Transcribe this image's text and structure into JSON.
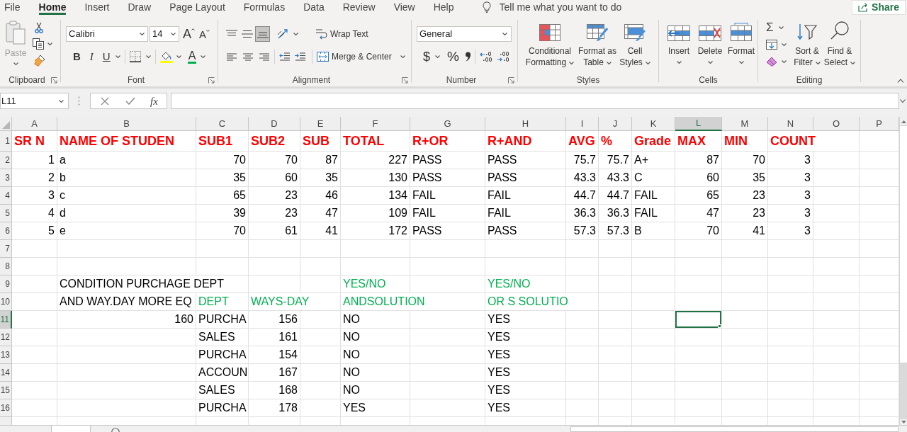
{
  "tabs": [
    {
      "label": "File",
      "selected": false
    },
    {
      "label": "Home",
      "selected": true
    },
    {
      "label": "Insert",
      "selected": false
    },
    {
      "label": "Draw",
      "selected": false
    },
    {
      "label": "Page Layout",
      "selected": false
    },
    {
      "label": "Formulas",
      "selected": false
    },
    {
      "label": "Data",
      "selected": false
    },
    {
      "label": "Review",
      "selected": false
    },
    {
      "label": "View",
      "selected": false
    },
    {
      "label": "Help",
      "selected": false
    }
  ],
  "tell_me": {
    "placeholder": "Tell me what you want to do"
  },
  "share_button": {
    "label": "Share"
  },
  "ribbon": {
    "clipboard": {
      "label": "Clipboard",
      "paste": {
        "label": "Paste",
        "disabled": true
      }
    },
    "font": {
      "label": "Font",
      "font_name": "Calibri",
      "font_size": "14",
      "grow_font": "A",
      "shrink_font": "A",
      "bold": "B",
      "italic": "I",
      "underline": "U",
      "font_color": "A"
    },
    "alignment": {
      "label": "Alignment",
      "vertical_align": [
        {
          "kind": "top",
          "selected": false
        },
        {
          "kind": "middle",
          "selected": false
        },
        {
          "kind": "bottom",
          "selected": true
        }
      ],
      "wrap_text": "Wrap Text",
      "merge_center": "Merge & Center"
    },
    "number": {
      "label": "Number",
      "format": "General",
      "currency": "$",
      "percent": "%"
    },
    "styles": {
      "label": "Styles",
      "buttons": [
        {
          "kind": "conditional",
          "lines": [
            "Conditional",
            "Formatting"
          ]
        },
        {
          "kind": "table",
          "lines": [
            "Format as",
            "Table"
          ]
        },
        {
          "kind": "cell_styles",
          "lines": [
            "Cell",
            "Styles"
          ]
        }
      ]
    },
    "cells": {
      "label": "Cells",
      "buttons": [
        {
          "kind": "insert",
          "label": "Insert"
        },
        {
          "kind": "delete",
          "label": "Delete"
        },
        {
          "kind": "format",
          "label": "Format"
        }
      ]
    },
    "editing": {
      "label": "Editing",
      "autosum": "Σ",
      "buttons": [
        {
          "kind": "sort",
          "lines": [
            "Sort &",
            "Filter"
          ]
        },
        {
          "kind": "find",
          "lines": [
            "Find &",
            "Select"
          ]
        }
      ]
    }
  },
  "formula_bar": {
    "name_box": "L11",
    "function_button": "fx"
  },
  "sheet": {
    "columns": [
      {
        "label": "A",
        "selected": false
      },
      {
        "label": "B",
        "selected": false
      },
      {
        "label": "C",
        "selected": false
      },
      {
        "label": "D",
        "selected": false
      },
      {
        "label": "E",
        "selected": false
      },
      {
        "label": "F",
        "selected": false
      },
      {
        "label": "G",
        "selected": false
      },
      {
        "label": "H",
        "selected": false
      },
      {
        "label": "I",
        "selected": false
      },
      {
        "label": "J",
        "selected": false
      },
      {
        "label": "K",
        "selected": false
      },
      {
        "label": "L",
        "selected": true
      },
      {
        "label": "M",
        "selected": false
      },
      {
        "label": "N",
        "selected": false
      },
      {
        "label": "O",
        "selected": false
      },
      {
        "label": "P",
        "selected": false
      }
    ],
    "rows": [
      {
        "header": "1",
        "selected": false,
        "kind": "heading",
        "cells": [
          {
            "text": "SR N",
            "numeric": false,
            "color": "#ff0000"
          },
          {
            "text": "NAME OF STUDEN",
            "numeric": false,
            "color": "#ff0000"
          },
          {
            "text": "SUB1",
            "numeric": false,
            "color": "#ff0000"
          },
          {
            "text": "SUB2",
            "numeric": false,
            "color": "#ff0000"
          },
          {
            "text": "SUB",
            "numeric": false,
            "color": "#ff0000"
          },
          {
            "text": "TOTAL",
            "numeric": false,
            "color": "#ff0000"
          },
          {
            "text": "R+OR",
            "numeric": false,
            "color": "#ff0000"
          },
          {
            "text": "R+AND",
            "numeric": false,
            "color": "#ff0000"
          },
          {
            "text": "AVG",
            "numeric": false,
            "color": "#ff0000"
          },
          {
            "text": "%",
            "numeric": false,
            "color": "#ff0000"
          },
          {
            "text": "Grade",
            "numeric": false,
            "color": "#ff0000"
          },
          {
            "text": "MAX",
            "numeric": false,
            "color": "#ff0000"
          },
          {
            "text": "MIN",
            "numeric": false,
            "color": "#ff0000"
          },
          {
            "text": "COUNT",
            "numeric": false,
            "color": "#ff0000"
          },
          null,
          null
        ]
      },
      {
        "header": "2",
        "selected": false,
        "kind": "body",
        "cells": [
          {
            "text": "1",
            "numeric": true,
            "color": "#000000"
          },
          {
            "text": "a",
            "numeric": false,
            "color": "#000000"
          },
          {
            "text": "70",
            "numeric": true,
            "color": "#000000"
          },
          {
            "text": "70",
            "numeric": true,
            "color": "#000000"
          },
          {
            "text": "87",
            "numeric": true,
            "color": "#000000"
          },
          {
            "text": "227",
            "numeric": true,
            "color": "#000000"
          },
          {
            "text": "PASS",
            "numeric": false,
            "color": "#000000"
          },
          {
            "text": "PASS",
            "numeric": false,
            "color": "#000000"
          },
          {
            "text": "75.7",
            "numeric": true,
            "color": "#000000"
          },
          {
            "text": "75.7",
            "numeric": true,
            "color": "#000000"
          },
          {
            "text": "A+",
            "numeric": false,
            "color": "#000000"
          },
          {
            "text": "87",
            "numeric": true,
            "color": "#000000"
          },
          {
            "text": "70",
            "numeric": true,
            "color": "#000000"
          },
          {
            "text": "3",
            "numeric": true,
            "color": "#000000"
          },
          null,
          null
        ]
      },
      {
        "header": "3",
        "selected": false,
        "kind": "body",
        "cells": [
          {
            "text": "2",
            "numeric": true,
            "color": "#000000"
          },
          {
            "text": "b",
            "numeric": false,
            "color": "#000000"
          },
          {
            "text": "35",
            "numeric": true,
            "color": "#000000"
          },
          {
            "text": "60",
            "numeric": true,
            "color": "#000000"
          },
          {
            "text": "35",
            "numeric": true,
            "color": "#000000"
          },
          {
            "text": "130",
            "numeric": true,
            "color": "#000000"
          },
          {
            "text": "PASS",
            "numeric": false,
            "color": "#000000"
          },
          {
            "text": "PASS",
            "numeric": false,
            "color": "#000000"
          },
          {
            "text": "43.3",
            "numeric": true,
            "color": "#000000"
          },
          {
            "text": "43.3",
            "numeric": true,
            "color": "#000000"
          },
          {
            "text": "C",
            "numeric": false,
            "color": "#000000"
          },
          {
            "text": "60",
            "numeric": true,
            "color": "#000000"
          },
          {
            "text": "35",
            "numeric": true,
            "color": "#000000"
          },
          {
            "text": "3",
            "numeric": true,
            "color": "#000000"
          },
          null,
          null
        ]
      },
      {
        "header": "4",
        "selected": false,
        "kind": "body",
        "cells": [
          {
            "text": "3",
            "numeric": true,
            "color": "#000000"
          },
          {
            "text": "c",
            "numeric": false,
            "color": "#000000"
          },
          {
            "text": "65",
            "numeric": true,
            "color": "#000000"
          },
          {
            "text": "23",
            "numeric": true,
            "color": "#000000"
          },
          {
            "text": "46",
            "numeric": true,
            "color": "#000000"
          },
          {
            "text": "134",
            "numeric": true,
            "color": "#000000"
          },
          {
            "text": "FAIL",
            "numeric": false,
            "color": "#000000"
          },
          {
            "text": "FAIL",
            "numeric": false,
            "color": "#000000"
          },
          {
            "text": "44.7",
            "numeric": true,
            "color": "#000000"
          },
          {
            "text": "44.7",
            "numeric": true,
            "color": "#000000"
          },
          {
            "text": "FAIL",
            "numeric": false,
            "color": "#000000"
          },
          {
            "text": "65",
            "numeric": true,
            "color": "#000000"
          },
          {
            "text": "23",
            "numeric": true,
            "color": "#000000"
          },
          {
            "text": "3",
            "numeric": true,
            "color": "#000000"
          },
          null,
          null
        ]
      },
      {
        "header": "5",
        "selected": false,
        "kind": "body",
        "cells": [
          {
            "text": "4",
            "numeric": true,
            "color": "#000000"
          },
          {
            "text": "d",
            "numeric": false,
            "color": "#000000"
          },
          {
            "text": "39",
            "numeric": true,
            "color": "#000000"
          },
          {
            "text": "23",
            "numeric": true,
            "color": "#000000"
          },
          {
            "text": "47",
            "numeric": true,
            "color": "#000000"
          },
          {
            "text": "109",
            "numeric": true,
            "color": "#000000"
          },
          {
            "text": "FAIL",
            "numeric": false,
            "color": "#000000"
          },
          {
            "text": "FAIL",
            "numeric": false,
            "color": "#000000"
          },
          {
            "text": "36.3",
            "numeric": true,
            "color": "#000000"
          },
          {
            "text": "36.3",
            "numeric": true,
            "color": "#000000"
          },
          {
            "text": "FAIL",
            "numeric": false,
            "color": "#000000"
          },
          {
            "text": "47",
            "numeric": true,
            "color": "#000000"
          },
          {
            "text": "23",
            "numeric": true,
            "color": "#000000"
          },
          {
            "text": "3",
            "numeric": true,
            "color": "#000000"
          },
          null,
          null
        ]
      },
      {
        "header": "6",
        "selected": false,
        "kind": "body",
        "cells": [
          {
            "text": "5",
            "numeric": true,
            "color": "#000000"
          },
          {
            "text": "e",
            "numeric": false,
            "color": "#000000"
          },
          {
            "text": "70",
            "numeric": true,
            "color": "#000000"
          },
          {
            "text": "61",
            "numeric": true,
            "color": "#000000"
          },
          {
            "text": "41",
            "numeric": true,
            "color": "#000000"
          },
          {
            "text": "172",
            "numeric": true,
            "color": "#000000"
          },
          {
            "text": "PASS",
            "numeric": false,
            "color": "#000000"
          },
          {
            "text": "PASS",
            "numeric": false,
            "color": "#000000"
          },
          {
            "text": "57.3",
            "numeric": true,
            "color": "#000000"
          },
          {
            "text": "57.3",
            "numeric": true,
            "color": "#000000"
          },
          {
            "text": "B",
            "numeric": false,
            "color": "#000000"
          },
          {
            "text": "70",
            "numeric": true,
            "color": "#000000"
          },
          {
            "text": "41",
            "numeric": true,
            "color": "#000000"
          },
          {
            "text": "3",
            "numeric": true,
            "color": "#000000"
          },
          null,
          null
        ]
      },
      {
        "header": "7",
        "selected": false,
        "kind": "body"
      },
      {
        "header": "8",
        "selected": false,
        "kind": "body"
      },
      {
        "header": "9",
        "selected": false,
        "kind": "body",
        "cells": [
          null,
          {
            "text": "CONDITION PURCHAGE DEPT",
            "numeric": false,
            "color": "#000000"
          },
          null,
          null,
          null,
          {
            "text": "YES/NO",
            "numeric": false,
            "color": "#00b050"
          },
          null,
          {
            "text": "YES/NO",
            "numeric": false,
            "color": "#00b050"
          },
          null,
          null,
          null,
          null,
          null,
          null,
          null,
          null
        ]
      },
      {
        "header": "10",
        "selected": false,
        "kind": "body",
        "cells": [
          null,
          {
            "text": "AND WAY.DAY MORE EQ",
            "numeric": false,
            "color": "#000000"
          },
          {
            "text": "DEPT",
            "numeric": false,
            "color": "#00b050"
          },
          {
            "text": "WAYS-DAY",
            "numeric": false,
            "color": "#00b050"
          },
          null,
          {
            "text": "ANDSOLUTION",
            "numeric": false,
            "color": "#00b050"
          },
          null,
          {
            "text": "OR S SOLUTIO",
            "numeric": false,
            "color": "#00b050"
          },
          null,
          null,
          null,
          null,
          null,
          null,
          null,
          null
        ]
      },
      {
        "header": "11",
        "selected": true,
        "kind": "body",
        "cells": [
          null,
          {
            "text": "160",
            "numeric": true,
            "color": "#000000"
          },
          {
            "text": "PURCHA",
            "numeric": false,
            "color": "#000000"
          },
          {
            "text": "156",
            "numeric": true,
            "color": "#000000"
          },
          null,
          {
            "text": "NO",
            "numeric": false,
            "color": "#000000"
          },
          null,
          {
            "text": "YES",
            "numeric": false,
            "color": "#000000"
          },
          null,
          null,
          null,
          null,
          null,
          null,
          null,
          null
        ]
      },
      {
        "header": "12",
        "selected": false,
        "kind": "body",
        "cells": [
          null,
          null,
          {
            "text": "SALES",
            "numeric": false,
            "color": "#000000"
          },
          {
            "text": "161",
            "numeric": true,
            "color": "#000000"
          },
          null,
          {
            "text": "NO",
            "numeric": false,
            "color": "#000000"
          },
          null,
          {
            "text": "YES",
            "numeric": false,
            "color": "#000000"
          },
          null,
          null,
          null,
          null,
          null,
          null,
          null,
          null
        ]
      },
      {
        "header": "13",
        "selected": false,
        "kind": "body",
        "cells": [
          null,
          null,
          {
            "text": "PURCHA",
            "numeric": false,
            "color": "#000000"
          },
          {
            "text": "154",
            "numeric": true,
            "color": "#000000"
          },
          null,
          {
            "text": "NO",
            "numeric": false,
            "color": "#000000"
          },
          null,
          {
            "text": "YES",
            "numeric": false,
            "color": "#000000"
          },
          null,
          null,
          null,
          null,
          null,
          null,
          null,
          null
        ]
      },
      {
        "header": "14",
        "selected": false,
        "kind": "body",
        "cells": [
          null,
          null,
          {
            "text": "ACCOUN",
            "numeric": false,
            "color": "#000000"
          },
          {
            "text": "167",
            "numeric": true,
            "color": "#000000"
          },
          null,
          {
            "text": "NO",
            "numeric": false,
            "color": "#000000"
          },
          null,
          {
            "text": "YES",
            "numeric": false,
            "color": "#000000"
          },
          null,
          null,
          null,
          null,
          null,
          null,
          null,
          null
        ]
      },
      {
        "header": "15",
        "selected": false,
        "kind": "body",
        "cells": [
          null,
          null,
          {
            "text": "SALES",
            "numeric": false,
            "color": "#000000"
          },
          {
            "text": "168",
            "numeric": true,
            "color": "#000000"
          },
          null,
          {
            "text": "NO",
            "numeric": false,
            "color": "#000000"
          },
          null,
          {
            "text": "YES",
            "numeric": false,
            "color": "#000000"
          },
          null,
          null,
          null,
          null,
          null,
          null,
          null,
          null
        ]
      },
      {
        "header": "16",
        "selected": false,
        "kind": "body",
        "cells": [
          null,
          null,
          {
            "text": "PURCHA",
            "numeric": false,
            "color": "#000000"
          },
          {
            "text": "178",
            "numeric": true,
            "color": "#000000"
          },
          null,
          {
            "text": "YES",
            "numeric": false,
            "color": "#000000"
          },
          null,
          {
            "text": "YES",
            "numeric": false,
            "color": "#000000"
          },
          null,
          null,
          null,
          null,
          null,
          null,
          null,
          null
        ]
      }
    ]
  }
}
